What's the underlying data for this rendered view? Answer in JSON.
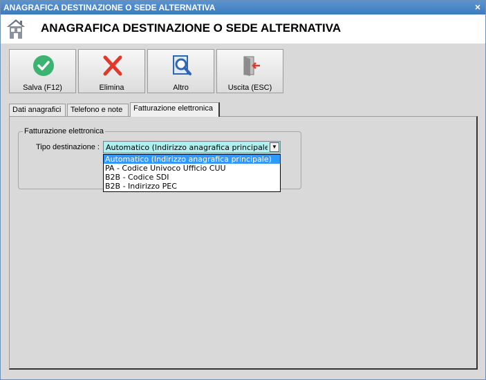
{
  "window": {
    "title": "ANAGRAFICA DESTINAZIONE O SEDE ALTERNATIVA",
    "close_glyph": "×"
  },
  "header": {
    "icon": "home-icon",
    "title": "ANAGRAFICA DESTINAZIONE O SEDE ALTERNATIVA"
  },
  "toolbar": {
    "buttons": [
      {
        "label": "Salva (F12)",
        "icon": "check-icon",
        "color": "#3cb371"
      },
      {
        "label": "Elimina",
        "icon": "delete-x-icon",
        "color": "#e0392b"
      },
      {
        "label": "Altro",
        "icon": "search-document-icon",
        "color": "#2f66b3"
      },
      {
        "label": "Uscita (ESC)",
        "icon": "exit-door-icon",
        "color": "#e0392b"
      }
    ]
  },
  "tabs": [
    {
      "label": "Dati anagrafici",
      "active": false
    },
    {
      "label": "Telefono e note",
      "active": false
    },
    {
      "label": "Fatturazione elettronica",
      "active": true
    }
  ],
  "panel": {
    "group_title": "Fatturazione elettronica",
    "tipo_label": "Tipo destinazione :",
    "tipo_value": "Automatico (Indirizzo anagrafica principale)",
    "options": [
      "Automatico (Indirizzo anagrafica principale)",
      "PA - Codice Univoco Ufficio CUU",
      "B2B - Codice SDI",
      "B2B - Indirizzo PEC"
    ],
    "selected_index": 0
  }
}
